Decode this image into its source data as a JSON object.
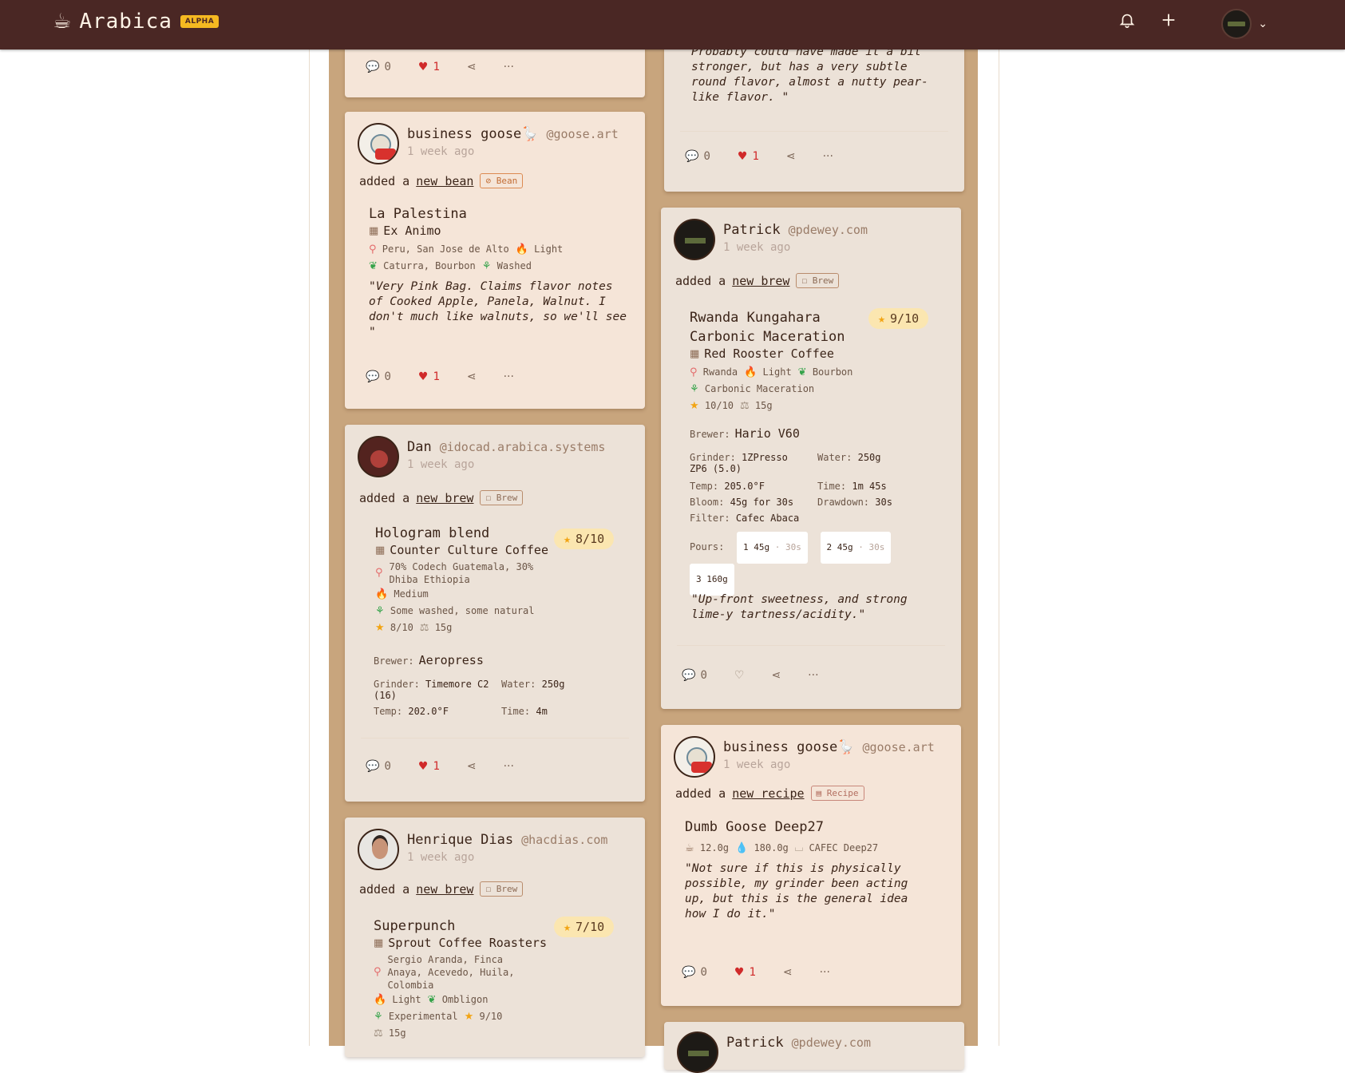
{
  "app": {
    "name": "Arabica",
    "badge": "ALPHA",
    "logo_icon": "coffee-cup-icon"
  },
  "nav": {
    "icons": [
      "bell-icon",
      "plus-icon",
      "avatar",
      "chevron-down-icon"
    ]
  },
  "posts": [
    {
      "id": "p0",
      "quote": "Probably could have made it a bit stronger, but has a very subtle round flavor, almost a nutty pear-like flavor. \"",
      "comments": "0",
      "likes": "1"
    },
    {
      "id": "p1",
      "comments": "0",
      "likes": "1"
    },
    {
      "id": "goose-bean",
      "user": "business goose🪿",
      "handle": "@goose.art",
      "when": "1 week ago",
      "added_prefix": "added a",
      "added_link": "new bean",
      "tag": "Bean",
      "title": "La Palestina",
      "roaster": "Ex Animo",
      "origin": "Peru, San Jose de Alto",
      "roast": "Light",
      "variety": "Caturra, Bourbon",
      "process": "Washed",
      "quote": "\"Very Pink Bag. Claims flavor notes of Cooked Apple, Panela, Walnut. I don't much like walnuts, so we'll see \"",
      "comments": "0",
      "likes": "1"
    },
    {
      "id": "patrick-brew",
      "user": "Patrick",
      "handle": "@pdewey.com",
      "when": "1 week ago",
      "added_prefix": "added a",
      "added_link": "new brew",
      "tag": "Brew",
      "title_line1": "Rwanda Kungahara",
      "title_line2": "Carbonic Maceration",
      "rating": "9/10",
      "roaster": "Red Rooster Coffee",
      "origin": "Rwanda",
      "roast": "Light",
      "variety": "Bourbon",
      "process": "Carbonic Maceration",
      "bean_rating": "10/10",
      "dose": "15g",
      "brewer_label": "Brewer:",
      "brewer": "Hario V60",
      "grinder_label": "Grinder:",
      "grinder": "1ZPresso ZP6 (5.0)",
      "water_label": "Water:",
      "water": "250g",
      "temp_label": "Temp:",
      "temp": "205.0°F",
      "time_label": "Time:",
      "time": "1m 45s",
      "bloom_label": "Bloom:",
      "bloom": "45g for 30s",
      "drawdown_label": "Drawdown:",
      "drawdown": "30s",
      "filter_label": "Filter:",
      "filter": "Cafec Abaca",
      "pours_label": "Pours:",
      "pours": [
        {
          "n": "1",
          "amt": "45g",
          "time": "30s"
        },
        {
          "n": "2",
          "amt": "45g",
          "time": "30s"
        },
        {
          "n": "3",
          "amt": "160g",
          "time": ""
        }
      ],
      "quote": "\"Up-front sweetness, and strong lime-y tartness/acidity.\"",
      "comments": "0",
      "likes": ""
    },
    {
      "id": "dan-brew",
      "user": "Dan",
      "handle": "@idocad.arabica.systems",
      "when": "1 week ago",
      "added_prefix": "added a",
      "added_link": "new brew",
      "tag": "Brew",
      "title": "Hologram blend",
      "rating": "8/10",
      "roaster": "Counter Culture Coffee",
      "origin": "70% Codech Guatemala, 30% Dhiba Ethiopia",
      "roast": "Medium",
      "process": "Some washed, some natural",
      "bean_rating": "8/10",
      "dose": "15g",
      "brewer_label": "Brewer:",
      "brewer": "Aeropress",
      "grinder_label": "Grinder:",
      "grinder": "Timemore C2 (16)",
      "water_label": "Water:",
      "water": "250g",
      "temp_label": "Temp:",
      "temp": "202.0°F",
      "time_label": "Time:",
      "time": "4m",
      "comments": "0",
      "likes": "1"
    },
    {
      "id": "goose-recipe",
      "user": "business goose🪿",
      "handle": "@goose.art",
      "when": "1 week ago",
      "added_prefix": "added a",
      "added_link": "new recipe",
      "tag": "Recipe",
      "title": "Dumb Goose Deep27",
      "dose": "12.0g",
      "water": "180.0g",
      "brewer": "CAFEC Deep27",
      "quote": "\"Not sure if this is physically possible, my grinder been acting up, but this is the general idea how I do it.\"",
      "comments": "0",
      "likes": "1"
    },
    {
      "id": "henrique-brew",
      "user": "Henrique Dias",
      "handle": "@hacdias.com",
      "when": "1 week ago",
      "added_prefix": "added a",
      "added_link": "new brew",
      "tag": "Brew",
      "title": "Superpunch",
      "rating": "7/10",
      "roaster": "Sprout Coffee Roasters",
      "origin": "Sergio Aranda, Finca Anaya, Acevedo, Huila, Colombia",
      "roast": "Light",
      "variety": "Ombligon",
      "process": "Experimental",
      "bean_rating": "9/10",
      "dose": "15g"
    },
    {
      "id": "patrick-partial",
      "user": "Patrick",
      "handle": "@pdewey.com"
    }
  ]
}
